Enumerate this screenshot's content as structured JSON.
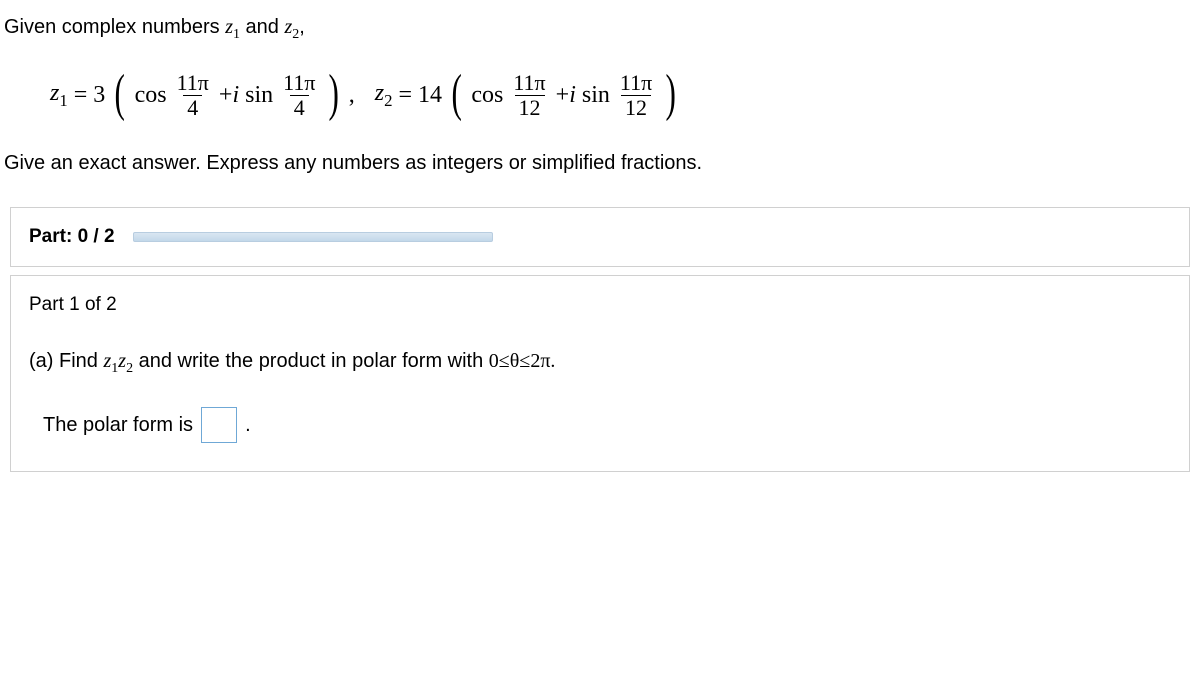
{
  "intro": {
    "prefix": "Given complex numbers ",
    "z1": "z",
    "z1_sub": "1",
    "mid": " and ",
    "z2": "z",
    "z2_sub": "2",
    "suffix": ","
  },
  "formula": {
    "z1_label": "z",
    "z1_sub": "1",
    "eq": "=",
    "z1_coef": "3",
    "cos": "cos",
    "z1_num": "11π",
    "z1_den": "4",
    "plus_i_sin": "+i sin",
    "z1_num2": "11π",
    "z1_den2": "4",
    "comma": ",",
    "z2_label": "z",
    "z2_sub": "2",
    "z2_coef": "14",
    "z2_num": "11π",
    "z2_den": "12",
    "z2_num2": "11π",
    "z2_den2": "12"
  },
  "instruction": "Give an exact answer. Express any numbers as integers or simplified fractions.",
  "progress": {
    "label": "Part: 0 / 2"
  },
  "part": {
    "title": "Part 1 of 2",
    "q_prefix": "(a)  Find ",
    "q_z1": "z",
    "q_z1_sub": "1",
    "q_z2": "z",
    "q_z2_sub": "2",
    "q_mid": " and write the product in polar form with ",
    "q_range": "0≤θ≤2π.",
    "answer_label": "The polar form is",
    "answer_suffix": "."
  }
}
